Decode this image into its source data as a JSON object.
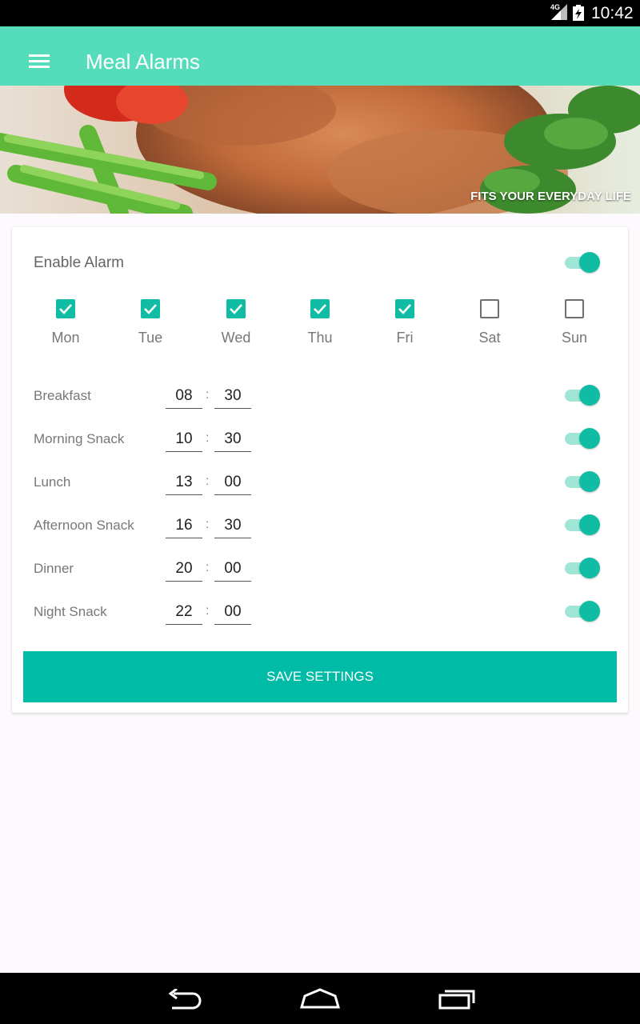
{
  "status_bar": {
    "time": "10:42",
    "network": "4G",
    "icons": [
      "signal-icon",
      "battery-charging-icon"
    ]
  },
  "app_bar": {
    "title": "Meal Alarms",
    "menu_icon": "hamburger-menu-icon"
  },
  "banner": {
    "tagline": "FITS YOUR EVERYDAY LIFE"
  },
  "settings": {
    "enable_label": "Enable Alarm",
    "enabled": true,
    "days": [
      {
        "label": "Mon",
        "checked": true
      },
      {
        "label": "Tue",
        "checked": true
      },
      {
        "label": "Wed",
        "checked": true
      },
      {
        "label": "Thu",
        "checked": true
      },
      {
        "label": "Fri",
        "checked": true
      },
      {
        "label": "Sat",
        "checked": false
      },
      {
        "label": "Sun",
        "checked": false
      }
    ],
    "separator": ":",
    "meals": [
      {
        "name": "Breakfast",
        "hour": "08",
        "minute": "30",
        "enabled": true
      },
      {
        "name": "Morning Snack",
        "hour": "10",
        "minute": "30",
        "enabled": true
      },
      {
        "name": "Lunch",
        "hour": "13",
        "minute": "00",
        "enabled": true
      },
      {
        "name": "Afternoon Snack",
        "hour": "16",
        "minute": "30",
        "enabled": true
      },
      {
        "name": "Dinner",
        "hour": "20",
        "minute": "00",
        "enabled": true
      },
      {
        "name": "Night Snack",
        "hour": "22",
        "minute": "00",
        "enabled": true
      }
    ],
    "save_label": "SAVE SETTINGS"
  },
  "nav_bar": {
    "icons": [
      "back-icon",
      "home-icon",
      "recents-icon"
    ]
  },
  "colors": {
    "app_bar": "#55dcbb",
    "accent": "#10bca4",
    "button": "#00bba5",
    "background": "#fdfafd"
  }
}
